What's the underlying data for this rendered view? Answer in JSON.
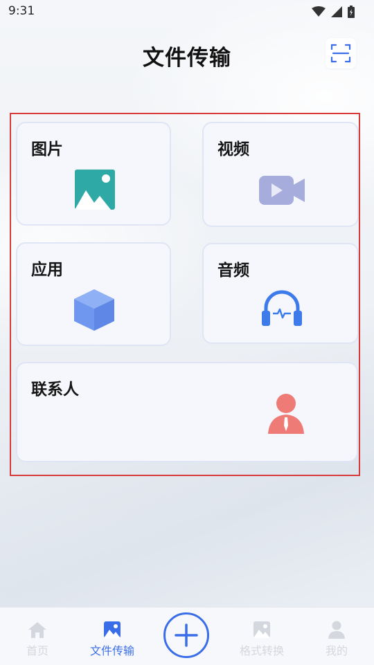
{
  "status_bar": {
    "time": "9:31"
  },
  "header": {
    "title": "文件传输"
  },
  "cards": {
    "images": "图片",
    "video": "视频",
    "apps": "应用",
    "audio": "音频",
    "contacts": "联系人"
  },
  "tabs": [
    {
      "label": "首页",
      "icon": "home-icon",
      "active": false
    },
    {
      "label": "文件传输",
      "icon": "image-icon",
      "active": true
    },
    {
      "label": "格式转换",
      "icon": "image-icon",
      "active": false
    },
    {
      "label": "我的",
      "icon": "person-icon",
      "active": false
    }
  ],
  "colors": {
    "accent": "#3a6ee8",
    "highlight": "#d83a3a",
    "image_icon": "#2fa9a6",
    "video_icon": "#a6acdc",
    "app_icon": "#6f97f0",
    "audio_icon": "#3d7bea",
    "contact_icon": "#ef7b77",
    "tab_inactive": "#d4d7de"
  }
}
